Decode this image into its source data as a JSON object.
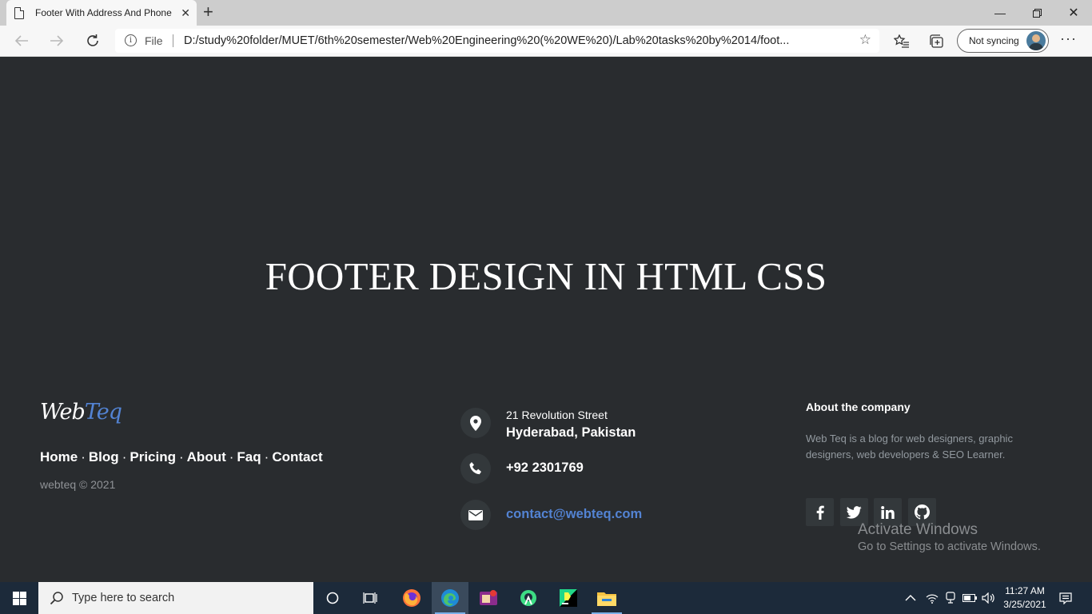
{
  "browser": {
    "tab_title": "Footer With Address And Phone",
    "address_prefix": "File",
    "url": "D:/study%20folder/MUET/6th%20semester/Web%20Engineering%20(%20WE%20)/Lab%20tasks%20by%2014/foot...",
    "sync_label": "Not syncing"
  },
  "page": {
    "heading": "FOOTER DESIGN IN HTML CSS",
    "logo_part1": "Web",
    "logo_part2": "Teq",
    "nav_links": [
      "Home",
      "Blog",
      "Pricing",
      "About",
      "Faq",
      "Contact"
    ],
    "separator": "·",
    "copyright": "webteq © 2021",
    "address_line1": "21 Revolution Street",
    "address_line2": "Hyderabad, Pakistan",
    "phone": "+92 2301769",
    "email": "contact@webteq.com",
    "about_heading": "About the company",
    "about_text": "Web Teq is a blog for web designers, graphic designers, web developers & SEO Learner.",
    "social_icons": [
      "facebook-icon",
      "twitter-icon",
      "linkedin-icon",
      "github-icon"
    ],
    "accent_color": "#5383d3",
    "background_color": "#292c2f"
  },
  "watermark": {
    "title": "Activate Windows",
    "subtitle": "Go to Settings to activate Windows."
  },
  "taskbar": {
    "search_placeholder": "Type here to search",
    "time": "11:27 AM",
    "date": "3/25/2021"
  }
}
